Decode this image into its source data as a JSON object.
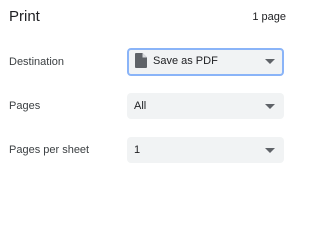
{
  "header": {
    "title": "Print",
    "page_count": "1 page"
  },
  "settings": [
    {
      "label": "Destination",
      "value": "Save as PDF",
      "icon": "document-icon",
      "focused": true
    },
    {
      "label": "Pages",
      "value": "All"
    },
    {
      "label": "Pages per sheet",
      "value": "1"
    }
  ],
  "colors": {
    "focus_outline": "#8ab4f8",
    "select_background": "#f1f3f4",
    "caret": "#5f6368",
    "text": "#202124"
  }
}
